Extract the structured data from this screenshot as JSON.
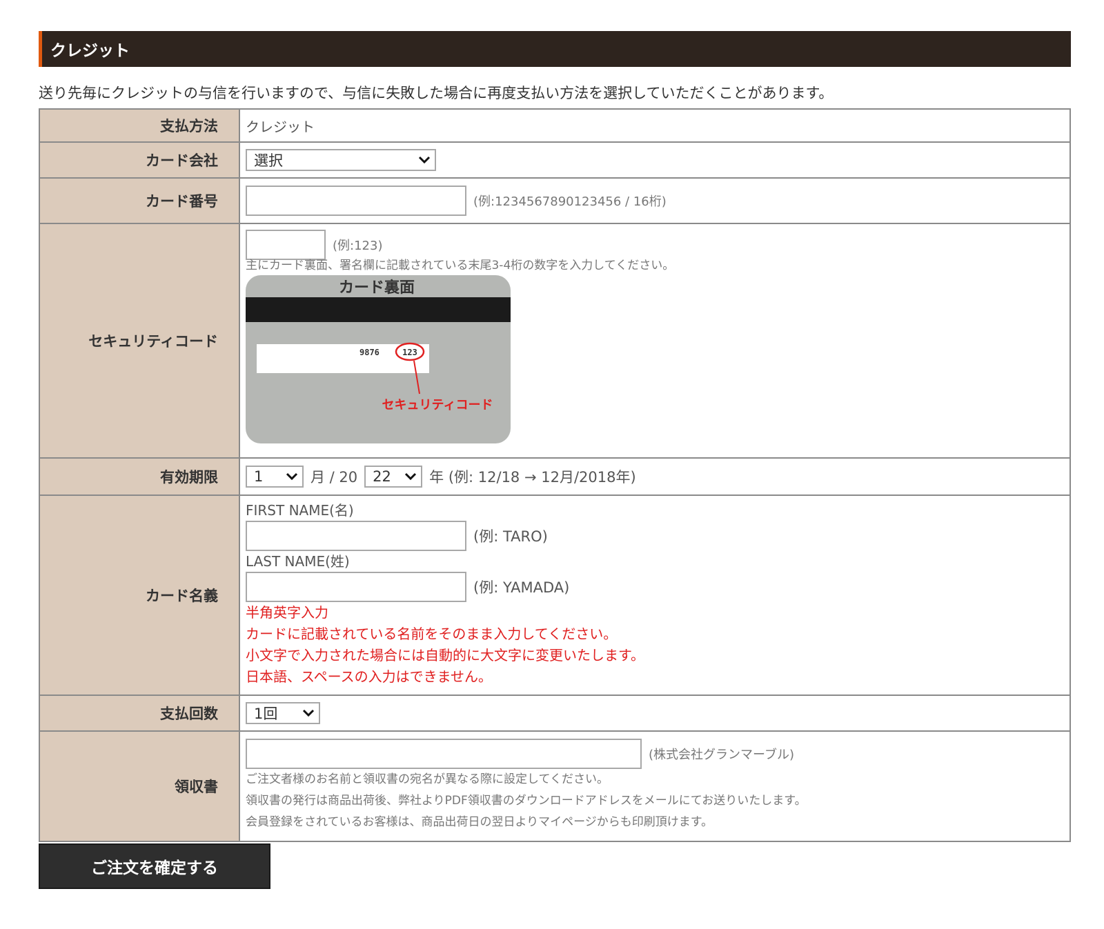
{
  "section": {
    "title": "クレジット"
  },
  "notice": "送り先毎にクレジットの与信を行いますので、与信に失敗した場合に再度支払い方法を選択していただくことがあります。",
  "rows": {
    "method": {
      "label": "支払方法",
      "value": "クレジット"
    },
    "card_company": {
      "label": "カード会社",
      "selected": "選択"
    },
    "card_number": {
      "label": "カード番号",
      "value": "",
      "hint": "(例:1234567890123456 / 16桁)"
    },
    "security": {
      "label": "セキュリティコード",
      "value": "",
      "hint": "(例:123)",
      "note": "主にカード裏面、署名欄に記載されている末尾3-4桁の数字を入力してください。",
      "image": {
        "title": "カード裏面",
        "digits": "9876",
        "code": "123",
        "caption": "セキュリティコード"
      }
    },
    "expiry": {
      "label": "有効期限",
      "month": "1",
      "month_unit": "月 / 20",
      "year": "22",
      "year_unit": "年 (例: 12/18 → 12月/2018年)"
    },
    "card_name": {
      "label": "カード名義",
      "first_label": "FIRST NAME(名)",
      "first_value": "",
      "first_hint": "(例: TARO)",
      "last_label": "LAST NAME(姓)",
      "last_value": "",
      "last_hint": "(例: YAMADA)",
      "notes": [
        "半角英字入力",
        "カードに記載されている名前をそのまま入力してください。",
        "小文字で入力された場合には自動的に大文字に変更いたします。",
        "日本語、スペースの入力はできません。"
      ]
    },
    "installments": {
      "label": "支払回数",
      "selected": "1回"
    },
    "receipt": {
      "label": "領収書",
      "value": "",
      "hint": "(株式会社グランマーブル)",
      "notes": [
        "ご注文者様のお名前と領収書の宛名が異なる際に設定してください。",
        "領収書の発行は商品出荷後、弊社よりPDF領収書のダウンロードアドレスをメールにてお送りいたします。",
        "会員登録をされているお客様は、商品出荷日の翌日よりマイページからも印刷頂けます。"
      ]
    }
  },
  "submit": {
    "label": "ご注文を確定する"
  },
  "colors": {
    "header_bg": "#2e241e",
    "header_accent": "#e05a10",
    "label_bg": "#dccbbb",
    "warning_red": "#e02020",
    "button_bg": "#2e2e2e"
  },
  "icons": {
    "dropdown": "chevron-down-icon"
  }
}
